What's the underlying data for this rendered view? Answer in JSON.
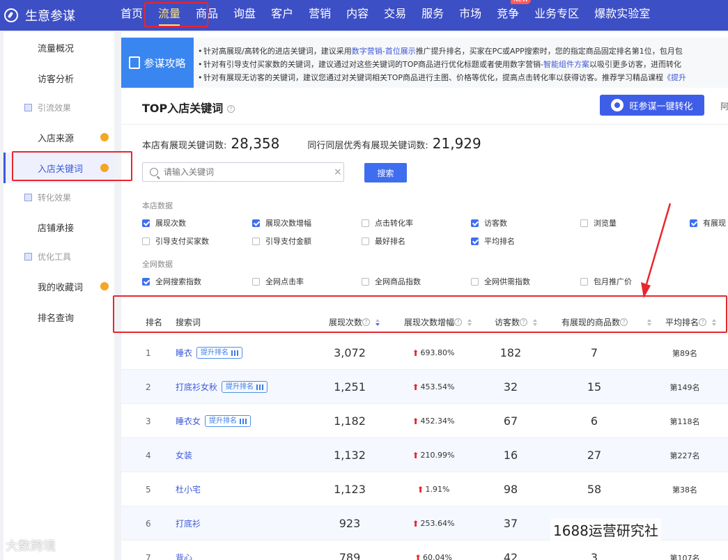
{
  "app": {
    "name": "生意参谋"
  },
  "topnav": {
    "items": [
      {
        "label": "首页"
      },
      {
        "label": "流量"
      },
      {
        "label": "商品"
      },
      {
        "label": "询盘"
      },
      {
        "label": "客户"
      },
      {
        "label": "营销"
      },
      {
        "label": "内容"
      },
      {
        "label": "交易"
      },
      {
        "label": "服务"
      },
      {
        "label": "市场"
      },
      {
        "label": "竞争",
        "badge": "NEW"
      },
      {
        "label": "业务专区"
      },
      {
        "label": "爆款实验室"
      }
    ],
    "active": "流量"
  },
  "sidebar": {
    "items": [
      {
        "label": "流量概况"
      },
      {
        "label": "访客分析"
      },
      {
        "group": "引流效果"
      },
      {
        "label": "入店来源"
      },
      {
        "label": "入店关键词"
      },
      {
        "group": "转化效果"
      },
      {
        "label": "店铺承接"
      },
      {
        "group": "优化工具"
      },
      {
        "label": "我的收藏词"
      },
      {
        "label": "排名查询"
      }
    ]
  },
  "tips": {
    "title": "参谋攻略",
    "line1_a": "针对高展现/高转化的进店关键词，建议采用",
    "line1_link": "数字营销-首位展示",
    "line1_b": "推广提升排名，买家在PC或APP搜索时，您的指定商品固定排名第1位，包月包",
    "line2_a": "针对有引导支付买家数的关键词，建议通过对这些关键词的TOP商品进行优化标题或者使用数字营销-",
    "line2_link": "智能组件方案",
    "line2_b": "以吸引更多访客，进而转化",
    "line3_a": "针对有展现无访客的关键词，建议您通过对关键词相关TOP商品进行主图、价格等优化，提高点击转化率以获得访客。推荐学习精品课程",
    "line3_link": "《提升"
  },
  "section": {
    "title": "TOP入店关键词",
    "convert_button": "旺参谋一键转化",
    "cut_text": "阿"
  },
  "stats": {
    "shop_label": "本店有展现关键词数:",
    "shop_value": "28,358",
    "peer_label": "同行同层优秀有展现关键词数:",
    "peer_value": "21,929"
  },
  "search": {
    "placeholder": "请输入关键词",
    "value": "",
    "button": "搜索",
    "clear": "×"
  },
  "filters": {
    "shop_label": "本店数据",
    "shop": [
      {
        "label": "展现次数",
        "checked": true
      },
      {
        "label": "展现次数增幅",
        "checked": true
      },
      {
        "label": "点击转化率",
        "checked": false
      },
      {
        "label": "访客数",
        "checked": true
      },
      {
        "label": "浏览量",
        "checked": false
      },
      {
        "label": "有展现",
        "checked": true
      },
      {
        "label": "引导支付买家数",
        "checked": false
      },
      {
        "label": "引导支付金额",
        "checked": false
      },
      {
        "label": "最好排名",
        "checked": false
      },
      {
        "label": "平均排名",
        "checked": true
      }
    ],
    "net_label": "全网数据",
    "net": [
      {
        "label": "全网搜索指数",
        "checked": true
      },
      {
        "label": "全网点击率",
        "checked": false
      },
      {
        "label": "全网商品指数",
        "checked": false
      },
      {
        "label": "全网供需指数",
        "checked": false
      },
      {
        "label": "包月推广价",
        "checked": false
      }
    ]
  },
  "table": {
    "headers": {
      "rank": "排名",
      "keyword": "搜索词",
      "impressions": "展现次数",
      "growth": "展现次数增幅",
      "visitors": "访客数",
      "products": "有展现的商品数",
      "avg_rank": "平均排名"
    },
    "boost_label": "提升排名",
    "rows": [
      {
        "rank": "1",
        "keyword": "睡衣",
        "boost": true,
        "impressions": "3,072",
        "growth": "693.80%",
        "visitors": "182",
        "products": "7",
        "avg_rank": "第89名"
      },
      {
        "rank": "2",
        "keyword": "打底衫女秋",
        "boost": true,
        "impressions": "1,251",
        "growth": "453.54%",
        "visitors": "32",
        "products": "15",
        "avg_rank": "第149名"
      },
      {
        "rank": "3",
        "keyword": "睡衣女",
        "boost": true,
        "impressions": "1,182",
        "growth": "452.34%",
        "visitors": "67",
        "products": "6",
        "avg_rank": "第118名"
      },
      {
        "rank": "4",
        "keyword": "女装",
        "boost": false,
        "impressions": "1,132",
        "growth": "210.99%",
        "visitors": "16",
        "products": "27",
        "avg_rank": "第227名"
      },
      {
        "rank": "5",
        "keyword": "杜小宅",
        "boost": false,
        "impressions": "1,123",
        "growth": "1.91%",
        "visitors": "98",
        "products": "58",
        "avg_rank": "第38名"
      },
      {
        "rank": "6",
        "keyword": "打底衫",
        "boost": false,
        "impressions": "923",
        "growth": "253.64%",
        "visitors": "37",
        "products": "",
        "avg_rank": ""
      },
      {
        "rank": "7",
        "keyword": "背心",
        "boost": false,
        "impressions": "789",
        "growth": "60.04%",
        "visitors": "42",
        "products": "3",
        "avg_rank": "第107名"
      }
    ]
  },
  "watermarks": {
    "left": "大数跨境",
    "right": "1688运营研究社"
  },
  "colors": {
    "nav": "#3d4fc5",
    "accent": "#3d6ff0",
    "highlight": "#e8262d",
    "dot": "#f5a623"
  }
}
